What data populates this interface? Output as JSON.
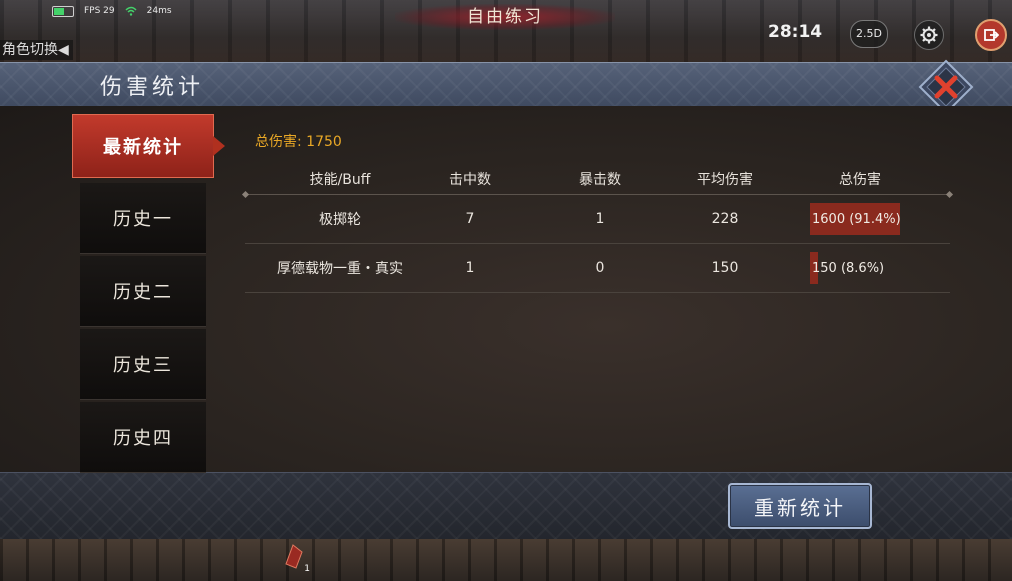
{
  "hud": {
    "fps": "FPS 29",
    "ping": "24ms",
    "mode_title": "自由练习",
    "timer": "28:14",
    "view_mode": "2.5D",
    "role_switch": "角色切换◀",
    "skill_count": "1"
  },
  "panel": {
    "title": "伤害统计",
    "tabs": [
      {
        "label": "最新统计",
        "active": true
      },
      {
        "label": "历史一",
        "active": false
      },
      {
        "label": "历史二",
        "active": false
      },
      {
        "label": "历史三",
        "active": false
      },
      {
        "label": "历史四",
        "active": false
      }
    ],
    "total_damage": "总伤害: 1750",
    "columns": [
      "技能/Buff",
      "击中数",
      "暴击数",
      "平均伤害",
      "总伤害"
    ],
    "rows": [
      {
        "skill": "极掷轮",
        "hits": "7",
        "crits": "1",
        "avg": "228",
        "total": "1600 (91.4%)",
        "share": 0.914
      },
      {
        "skill": "厚德载物一重・真实",
        "hits": "1",
        "crits": "0",
        "avg": "150",
        "total": "150 (8.6%)",
        "share": 0.086
      }
    ],
    "reset_label": "重新统计"
  },
  "colors": {
    "accent_red": "#b3382c",
    "gold_text": "#e9a826",
    "bar_fill": "#8a2a1e",
    "header_blue": "#4a566d"
  },
  "icons": [
    "battery-icon",
    "wifi-icon",
    "gear-icon",
    "exit-icon",
    "close-icon",
    "skill-icon"
  ]
}
